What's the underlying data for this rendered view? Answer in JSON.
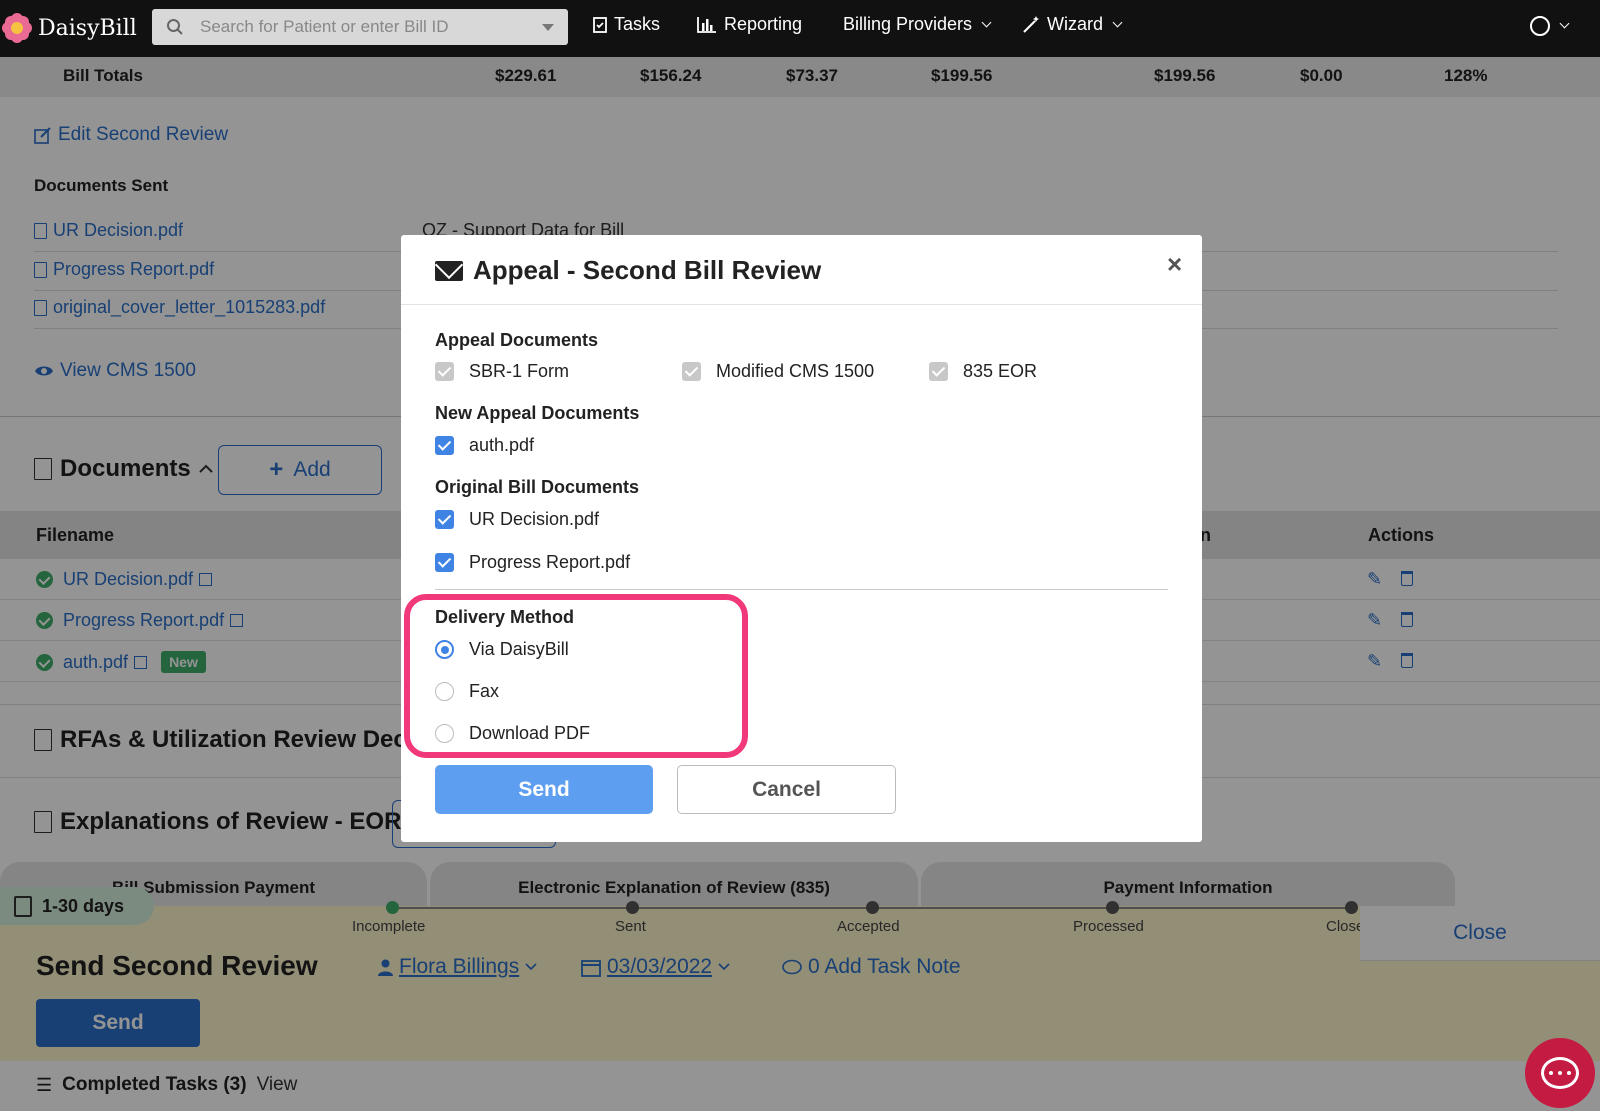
{
  "nav": {
    "brand": "DaisyBill",
    "search_placeholder": "Search for Patient or enter Bill ID",
    "items": [
      {
        "label": "Tasks",
        "icon": "clipboard-icon"
      },
      {
        "label": "Reporting",
        "icon": "bar-chart-icon"
      },
      {
        "label": "Billing Providers",
        "icon": "chevron-down-icon"
      },
      {
        "label": "Wizard",
        "icon": "magic-wand-icon"
      }
    ]
  },
  "bill_totals": {
    "label": "Bill Totals",
    "values": [
      "$229.61",
      "$156.24",
      "$73.37",
      "$199.56",
      "$199.56",
      "$0.00",
      "128%"
    ]
  },
  "second_review": {
    "edit_link": "Edit Second Review",
    "documents_sent_heading": "Documents Sent",
    "docs": [
      "UR Decision.pdf",
      "Progress Report.pdf",
      "original_cover_letter_1015283.pdf"
    ],
    "doc_note": "OZ - Support Data for Bill",
    "view_cms": "View CMS 1500"
  },
  "documents": {
    "heading": "Documents",
    "add_label": "Add",
    "col_filename": "Filename",
    "col_partial": "n",
    "col_actions": "Actions",
    "rows": [
      {
        "name": "UR Decision.pdf",
        "badge": ""
      },
      {
        "name": "Progress Report.pdf",
        "badge": ""
      },
      {
        "name": "auth.pdf",
        "badge": "New"
      }
    ]
  },
  "rfas_heading": "RFAs & Utilization Review Deci",
  "eor_heading": "Explanations of Review - EOR",
  "task_tabs": [
    "Bill Submission Payment",
    "Electronic Explanation of Review (835)",
    "Payment Information"
  ],
  "task": {
    "days": "1-30 days",
    "steps": [
      "Incomplete",
      "Sent",
      "Accepted",
      "Processed",
      "Closed"
    ],
    "title": "Send Second Review",
    "assignee": "Flora Billings",
    "date": "03/03/2022",
    "note_link": "0 Add Task Note",
    "close_label": "Close",
    "send_label": "Send",
    "completed_label": "Completed Tasks (3)",
    "view_label": "View"
  },
  "modal": {
    "title": "Appeal - Second Bill Review",
    "close_glyph": "×",
    "appeal_docs_label": "Appeal Documents",
    "appeal_docs": [
      "SBR-1 Form",
      "Modified CMS 1500",
      "835 EOR"
    ],
    "new_docs_label": "New Appeal Documents",
    "new_docs": [
      "auth.pdf"
    ],
    "orig_docs_label": "Original Bill Documents",
    "orig_docs": [
      "UR Decision.pdf",
      "Progress Report.pdf"
    ],
    "delivery_label": "Delivery Method",
    "delivery_options": [
      "Via DaisyBill",
      "Fax",
      "Download PDF"
    ],
    "delivery_selected": "Via DaisyBill",
    "send_label": "Send",
    "cancel_label": "Cancel",
    "highlight_color": "#f0387a"
  }
}
